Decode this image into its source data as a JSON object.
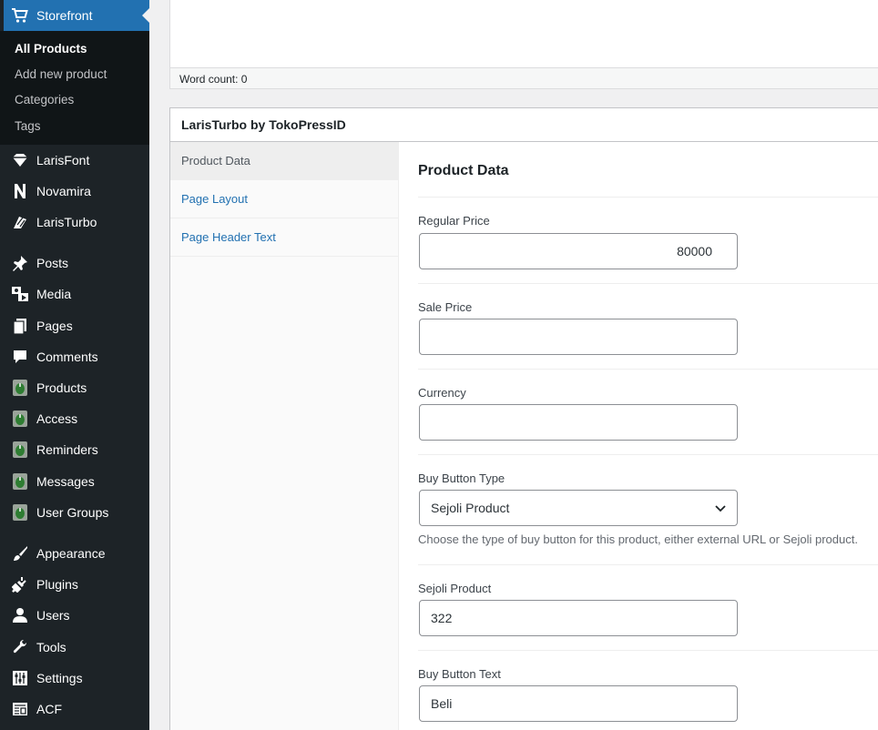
{
  "sidebar": {
    "active": {
      "label": "Storefront",
      "icon": "cart-icon"
    },
    "submenu": [
      {
        "label": "All Products",
        "current": true
      },
      {
        "label": "Add new product",
        "current": false
      },
      {
        "label": "Categories",
        "current": false
      },
      {
        "label": "Tags",
        "current": false
      }
    ],
    "items": [
      {
        "label": "LarisFont",
        "icon": "diamond-icon"
      },
      {
        "label": "Novamira",
        "icon": "n-logo-icon"
      },
      {
        "label": "LarisTurbo",
        "icon": "bolt-icon"
      },
      {
        "label": "Posts",
        "icon": "pin-icon"
      },
      {
        "label": "Media",
        "icon": "media-icon"
      },
      {
        "label": "Pages",
        "icon": "pages-icon"
      },
      {
        "label": "Comments",
        "icon": "comment-icon"
      },
      {
        "label": "Products",
        "icon": "sejoli-icon"
      },
      {
        "label": "Access",
        "icon": "sejoli-icon"
      },
      {
        "label": "Reminders",
        "icon": "sejoli-icon"
      },
      {
        "label": "Messages",
        "icon": "sejoli-icon"
      },
      {
        "label": "User Groups",
        "icon": "sejoli-icon"
      },
      {
        "label": "Appearance",
        "icon": "brush-icon"
      },
      {
        "label": "Plugins",
        "icon": "plugin-icon"
      },
      {
        "label": "Users",
        "icon": "user-icon"
      },
      {
        "label": "Tools",
        "icon": "wrench-icon"
      },
      {
        "label": "Settings",
        "icon": "settings-icon"
      },
      {
        "label": "ACF",
        "icon": "acf-icon"
      }
    ]
  },
  "editor": {
    "word_count": "Word count: 0"
  },
  "metabox": {
    "title": "LarisTurbo by TokoPressID",
    "tabs": [
      {
        "label": "Product Data",
        "active": true
      },
      {
        "label": "Page Layout",
        "active": false
      },
      {
        "label": "Page Header Text",
        "active": false
      }
    ],
    "section_title": "Product Data",
    "fields": {
      "regular_price": {
        "label": "Regular Price",
        "value": "80000"
      },
      "sale_price": {
        "label": "Sale Price",
        "value": ""
      },
      "currency": {
        "label": "Currency",
        "value": ""
      },
      "buy_button_type": {
        "label": "Buy Button Type",
        "value": "Sejoli Product",
        "description": "Choose the type of buy button for this product, either external URL or Sejoli product."
      },
      "sejoli_product": {
        "label": "Sejoli Product",
        "value": "322"
      },
      "buy_button_text": {
        "label": "Buy Button Text",
        "value": "Beli"
      }
    }
  },
  "colors": {
    "sidebar_bg": "#1d2327",
    "submenu_bg": "#101517",
    "accent": "#2271b1",
    "sejoli_green": "#3f7f3f"
  }
}
